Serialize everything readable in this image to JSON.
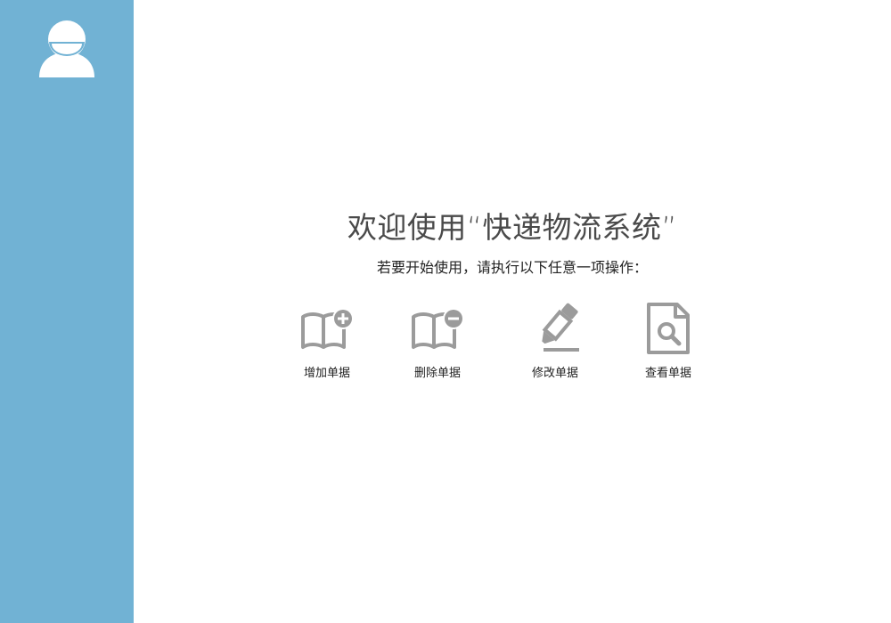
{
  "sidebar": {
    "avatar_icon": "user-avatar-icon",
    "background_color": "#71b2d4"
  },
  "main": {
    "welcome_title": "欢迎使用“快递物流系统”",
    "welcome_subtitle": "若要开始使用，请执行以下任意一项操作："
  },
  "actions": [
    {
      "label": "增加单据",
      "icon": "book-plus-icon"
    },
    {
      "label": "删除单据",
      "icon": "book-minus-icon"
    },
    {
      "label": "修改单据",
      "icon": "pencil-edit-icon"
    },
    {
      "label": "查看单据",
      "icon": "document-search-icon"
    }
  ],
  "colors": {
    "icon_gray": "#9b9b9b",
    "text": "#222222",
    "title_text": "#4a4a4a"
  }
}
